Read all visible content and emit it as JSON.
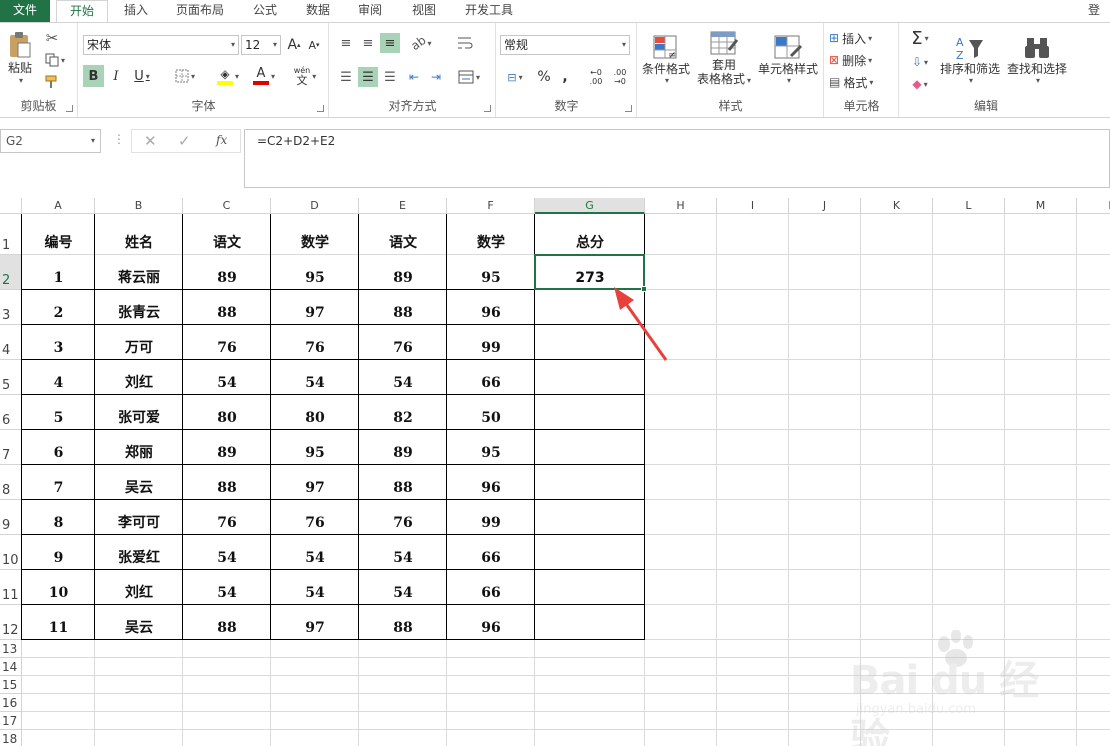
{
  "tabs": [
    "文件",
    "开始",
    "插入",
    "页面布局",
    "公式",
    "数据",
    "审阅",
    "视图",
    "开发工具"
  ],
  "account": "登录",
  "ribbon": {
    "clipboard": {
      "label": "剪贴板",
      "paste": "粘贴"
    },
    "font": {
      "label": "字体",
      "name": "宋体",
      "size": "12",
      "bold": "B",
      "italic": "I",
      "underline": "U",
      "grow": "A",
      "shrink": "A",
      "font_color": "A",
      "phonetic_top": "wén",
      "phonetic_bottom": "文"
    },
    "alignment": {
      "label": "对齐方式"
    },
    "number": {
      "label": "数字",
      "format": "常规",
      "percent": "%",
      "comma": ",",
      "inc_decimal": "←0 .00",
      "dec_decimal": ".00 →0"
    },
    "styles": {
      "label": "样式",
      "conditional": "条件格式",
      "table_format": "套用",
      "table_format2": "表格格式",
      "cell_styles": "单元格样式"
    },
    "cells": {
      "label": "单元格",
      "insert": "插入",
      "delete": "删除",
      "format": "格式"
    },
    "editing": {
      "label": "编辑",
      "sum": "Σ",
      "sort": "排序和筛选",
      "find": "查找和选择"
    }
  },
  "name_box": "G2",
  "formula": "=C2+D2+E2",
  "columns": [
    "A",
    "B",
    "C",
    "D",
    "E",
    "F",
    "G",
    "H",
    "I",
    "J",
    "K",
    "L",
    "M",
    "N"
  ],
  "rows": [
    "1",
    "2",
    "3",
    "4",
    "5",
    "6",
    "7",
    "8",
    "9",
    "10",
    "11",
    "12",
    "13",
    "14",
    "15",
    "16",
    "17",
    "18"
  ],
  "table": {
    "headers": [
      "编号",
      "姓名",
      "语文",
      "数学",
      "语文",
      "数学",
      "总分"
    ],
    "rows": [
      [
        "1",
        "蒋云丽",
        "89",
        "95",
        "89",
        "95",
        "273"
      ],
      [
        "2",
        "张青云",
        "88",
        "97",
        "88",
        "96",
        ""
      ],
      [
        "3",
        "万可",
        "76",
        "76",
        "76",
        "99",
        ""
      ],
      [
        "4",
        "刘红",
        "54",
        "54",
        "54",
        "66",
        ""
      ],
      [
        "5",
        "张可爱",
        "80",
        "80",
        "82",
        "50",
        ""
      ],
      [
        "6",
        "郑丽",
        "89",
        "95",
        "89",
        "95",
        ""
      ],
      [
        "7",
        "吴云",
        "88",
        "97",
        "88",
        "96",
        ""
      ],
      [
        "8",
        "李可可",
        "76",
        "76",
        "76",
        "99",
        ""
      ],
      [
        "9",
        "张爱红",
        "54",
        "54",
        "54",
        "66",
        ""
      ],
      [
        "10",
        "刘红",
        "54",
        "54",
        "54",
        "66",
        ""
      ],
      [
        "11",
        "吴云",
        "88",
        "97",
        "88",
        "96",
        ""
      ]
    ]
  },
  "watermark": {
    "brand": "Bai du 经验",
    "url": "jingyan.baidu.com"
  },
  "colors": {
    "accent": "#217346",
    "selection": "#a9d3b6",
    "arrow": "#e8403b"
  }
}
